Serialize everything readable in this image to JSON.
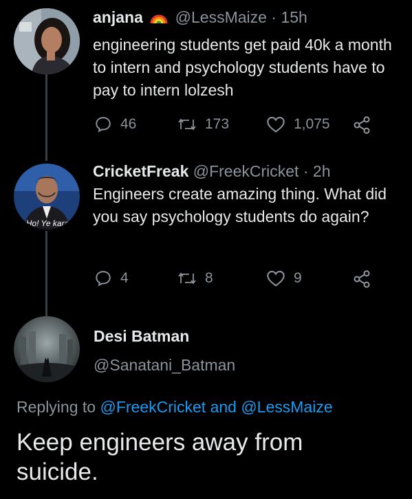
{
  "tweets": [
    {
      "name": "anjana",
      "handle": "@LessMaize",
      "time": "15h",
      "text": "engineering students get paid 40k a month to intern and psychology students have to pay to intern lolzesh",
      "replies": "46",
      "retweets": "173",
      "likes": "1,075"
    },
    {
      "name": "CricketFreak",
      "handle": "@FreekCricket",
      "time": "2h",
      "avatar_caption": "Ho! Ye kara",
      "text": "Engineers create amazing thing. What did you say psychology students do again?",
      "replies": "4",
      "retweets": "8",
      "likes": "9"
    }
  ],
  "main_tweet": {
    "name": "Desi Batman",
    "handle": "@Sanatani_Batman",
    "replying_prefix": "Replying to",
    "reply_user1": "@FreekCricket",
    "reply_and": "and",
    "reply_user2": "@LessMaize",
    "text": "Keep engineers away from suicide."
  },
  "colors": {
    "background": "#000000",
    "muted": "#8b949b",
    "link": "#1d9bf0",
    "thread_line": "#3a3f44"
  },
  "icons": [
    "reply-icon",
    "retweet-icon",
    "like-icon",
    "share-icon",
    "rainbow-emoji-icon"
  ]
}
